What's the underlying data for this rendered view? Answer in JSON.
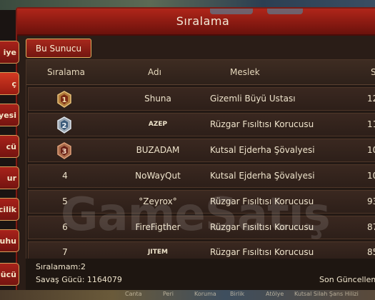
{
  "window": {
    "title": "Sıralama"
  },
  "side_tabs": [
    "iye",
    "ç",
    "yesi",
    "cü",
    "ur",
    "cilik",
    "uhu",
    "Gücü"
  ],
  "server_tab": "Bu Sunucu",
  "columns": {
    "rank": "Sıralama",
    "name": "Adı",
    "profession": "Meslek",
    "last": "S"
  },
  "rows": [
    {
      "rank": "1",
      "medal": "gold-medal-icon",
      "name": "Shuna",
      "profession": "Gizemli Büyü Ustası",
      "score": "12"
    },
    {
      "rank": "2",
      "medal": "silver-medal-icon",
      "name": "AZEP",
      "profession": "Rüzgar Fısıltısı Korucusu",
      "score": "11"
    },
    {
      "rank": "3",
      "medal": "bronze-medal-icon",
      "name": "BUZADAM",
      "profession": "Kutsal Ejderha Şövalyesi",
      "score": "10"
    },
    {
      "rank": "4",
      "name": "NoWayQut",
      "profession": "Kutsal Ejderha Şövalyesi",
      "score": "10"
    },
    {
      "rank": "5",
      "name": "°Zeyrox°",
      "profession": "Rüzgar Fısıltısı Korucusu",
      "score": "93"
    },
    {
      "rank": "6",
      "name": "FireFigther",
      "profession": "Rüzgar Fısıltısı Korucusu",
      "score": "87"
    },
    {
      "rank": "7",
      "name": "JITEM",
      "profession": "Rüzgar Fısıltısı Korucusu",
      "score": "85"
    }
  ],
  "watermark": "GameSatış",
  "footer": {
    "my_rank": "Sıralamam:2",
    "power": "Savaş Gücü: 1164079",
    "updated": "Son Güncelleme"
  },
  "bottom_bar": [
    "Canta",
    "Peri",
    "Koruma",
    "Birlik",
    "Atölye",
    "Kutsal Silah Şans Hilizi"
  ]
}
